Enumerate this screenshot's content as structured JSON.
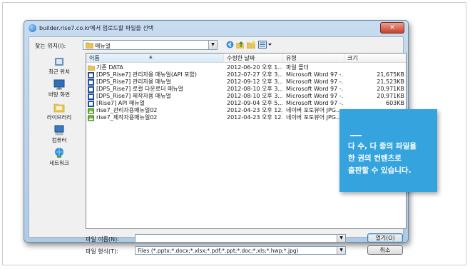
{
  "dialog": {
    "title": "builder.rise7.co.kr에서 업로드할 파일을 선택",
    "close_glyph": "✕",
    "lookin_label": "찾는 위치(I):",
    "lookin_value": "매뉴얼",
    "toolbar_icons": [
      "back-icon",
      "up-folder-icon",
      "new-folder-icon",
      "view-menu-icon"
    ]
  },
  "places": [
    {
      "label": "최근 위치",
      "icon": "recent-places-icon"
    },
    {
      "label": "바탕 화면",
      "icon": "desktop-icon"
    },
    {
      "label": "라이브러리",
      "icon": "libraries-icon"
    },
    {
      "label": "컴퓨터",
      "icon": "computer-icon"
    },
    {
      "label": "네트워크",
      "icon": "network-icon"
    }
  ],
  "columns": {
    "name": "이름",
    "date": "수정한 날짜",
    "type": "유형",
    "size": "크기"
  },
  "files": [
    {
      "name": "기존 DATA",
      "date": "2012-06-20 오후 1...",
      "type": "파일 폴더",
      "size": "",
      "icon": "folder"
    },
    {
      "name": "[DPS_Rise7] 관리자용 매뉴얼(API 포함)",
      "date": "2012-07-27 오후 3...",
      "type": "Microsoft Word 97 -...",
      "size": "21,675KB",
      "icon": "word"
    },
    {
      "name": "[DPS_Rise7] 관리자용 매뉴얼",
      "date": "2012-09-12 오후 3...",
      "type": "Microsoft Word 97 -...",
      "size": "21,523KB",
      "icon": "word"
    },
    {
      "name": "[DPS_Rise7] 로컬 다운로더 매뉴얼",
      "date": "2012-08-10 오후 3...",
      "type": "Microsoft Word 97 -...",
      "size": "20,971KB",
      "icon": "word"
    },
    {
      "name": "[DPS_Rise7] 제작자용 매뉴얼",
      "date": "2012-08-10 오후 3...",
      "type": "Microsoft Word 97 -...",
      "size": "20,971KB",
      "icon": "word"
    },
    {
      "name": "[Rise7] API 매뉴얼",
      "date": "2012-09-04 오후 5...",
      "type": "Microsoft Word 97 -...",
      "size": "603KB",
      "icon": "word"
    },
    {
      "name": "rise7_관리자용매뉴얼02",
      "date": "2012-04-23 오후 12...",
      "type": "네이버 포토뷰어 JPG...",
      "size": "",
      "icon": "jpg"
    },
    {
      "name": "rise7_제작자용매뉴얼02",
      "date": "2012-04-23 오후 12...",
      "type": "네이버 포토뷰어 JPG...",
      "size": "",
      "icon": "jpg"
    }
  ],
  "bottom": {
    "filename_label": "파일 이름(N):",
    "filename_value": "",
    "filetype_label": "파일 형식(T):",
    "filetype_value": "Files (*.pptx;*.docx;*.xlsx;*.pdf;*.ppt;*.doc;*.xls;*.hwp;*.jpg)",
    "open_button": "열기(O)",
    "cancel_button": "취소"
  },
  "callout": {
    "text": "다 수, 다 종의 파일을\n한 권의 컨텐츠로\n출판할 수 있습니다.",
    "color": "#35a3dd"
  }
}
